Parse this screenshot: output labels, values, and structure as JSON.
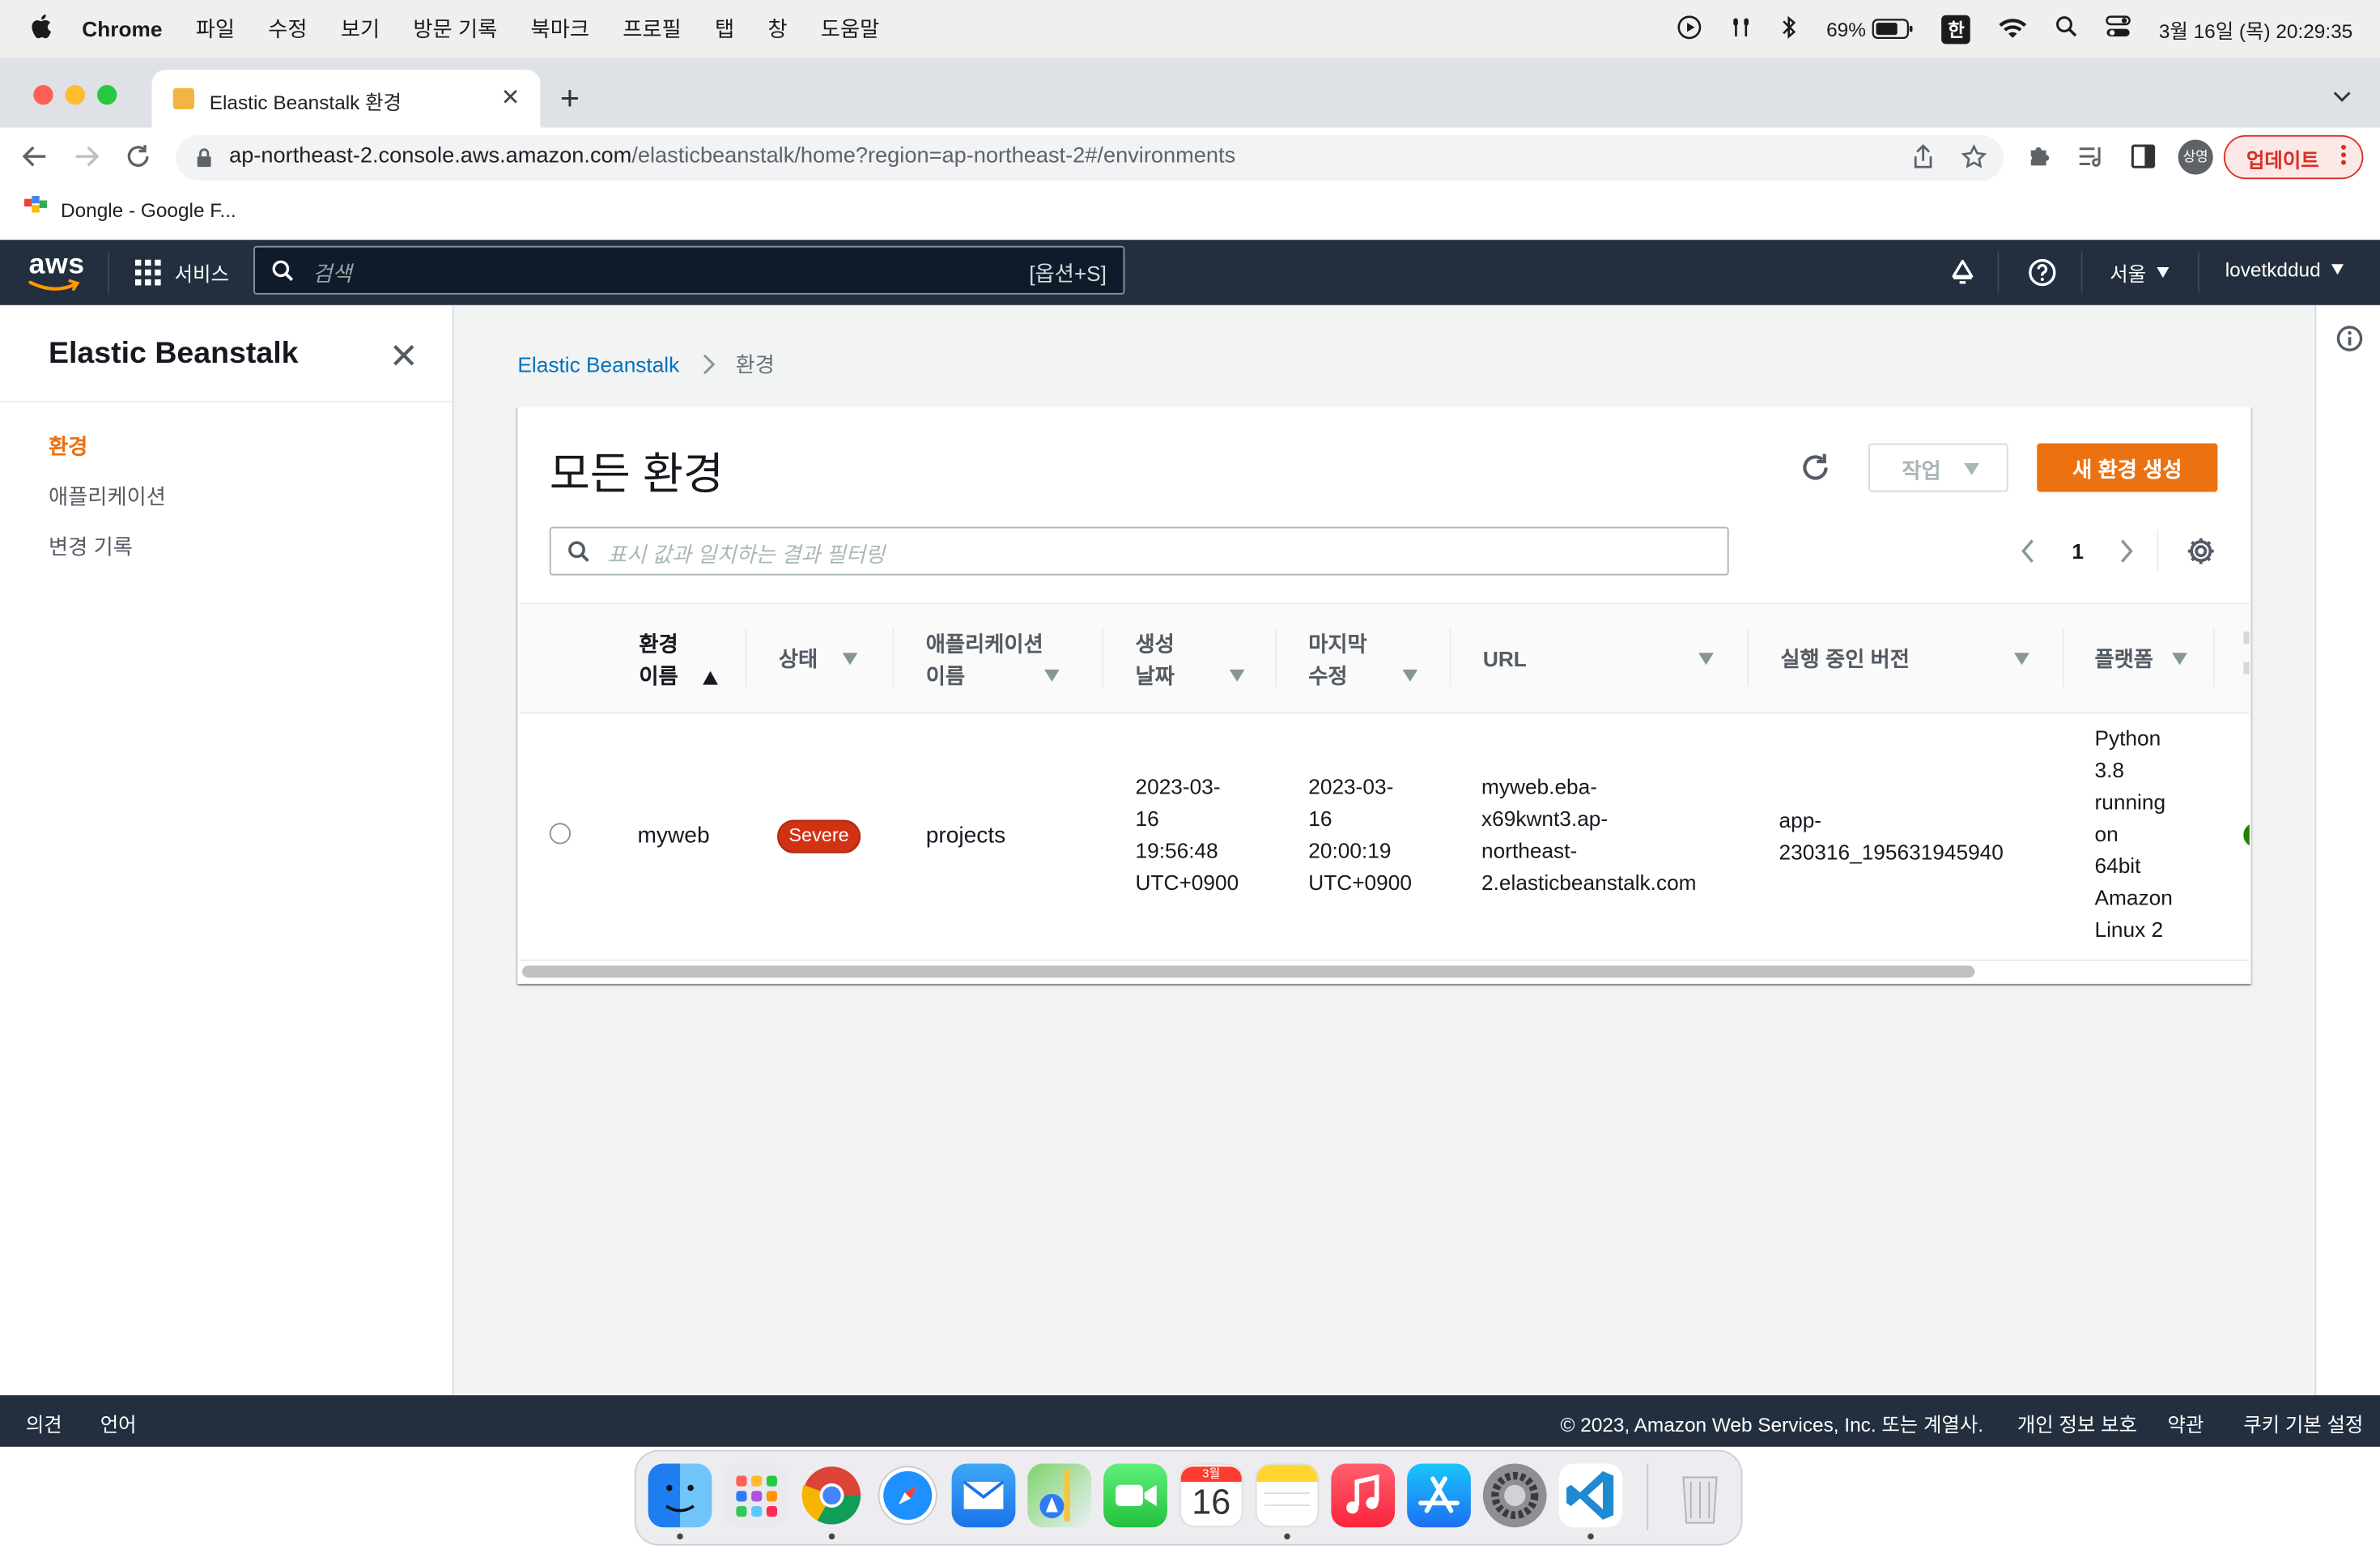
{
  "menubar": {
    "app": "Chrome",
    "items": [
      "파일",
      "수정",
      "보기",
      "방문 기록",
      "북마크",
      "프로필",
      "탭",
      "창",
      "도움말"
    ],
    "battery": "69%",
    "input_method": "한",
    "clock": "3월 16일 (목) 20:29:35"
  },
  "browser": {
    "tab_title": "Elastic Beanstalk 환경",
    "url_domain": "ap-northeast-2.console.aws.amazon.com",
    "url_path": "/elasticbeanstalk/home?region=ap-northeast-2#/environments",
    "profile_label": "상영",
    "update_label": "업데이트",
    "bookmark": "Dongle - Google F..."
  },
  "awsnav": {
    "logo": "aws",
    "services": "서비스",
    "search_placeholder": "검색",
    "search_shortcut": "[옵션+S]",
    "region": "서울",
    "account": "lovetkddud"
  },
  "sidenav": {
    "title": "Elastic Beanstalk",
    "items": [
      {
        "label": "환경",
        "active": true
      },
      {
        "label": "애플리케이션",
        "active": false
      },
      {
        "label": "변경 기록",
        "active": false
      }
    ]
  },
  "breadcrumb": {
    "root": "Elastic Beanstalk",
    "current": "환경"
  },
  "panel": {
    "title": "모든 환경",
    "actions_label": "작업",
    "create_label": "새 환경 생성",
    "filter_placeholder": "표시 값과 일치하는 결과 필터링",
    "page": "1"
  },
  "table": {
    "columns": [
      {
        "l1": "환경",
        "l2": "이름"
      },
      {
        "l1": "상태",
        "l2": ""
      },
      {
        "l1": "애플리케이션",
        "l2": "이름"
      },
      {
        "l1": "생성",
        "l2": "날짜"
      },
      {
        "l1": "마지막",
        "l2": "수정"
      },
      {
        "l1": "URL",
        "l2": ""
      },
      {
        "l1": "실행 중인 버전",
        "l2": ""
      },
      {
        "l1": "플랫폼",
        "l2": ""
      }
    ],
    "row": {
      "env_name": "myweb",
      "status": "Severe",
      "app_name": "projects",
      "created": [
        "2023-03-",
        "16",
        "19:56:48",
        "UTC+0900"
      ],
      "modified": [
        "2023-03-",
        "16",
        "20:00:19",
        "UTC+0900"
      ],
      "url": [
        "myweb.eba-",
        "x69kwnt3.ap-",
        "northeast-",
        "2.elasticbeanstalk.com"
      ],
      "version": [
        "app-",
        "230316_195631945940"
      ],
      "platform": [
        "Python",
        "3.8",
        "running",
        "on",
        "64bit",
        "Amazon",
        "Linux 2"
      ]
    }
  },
  "footer": {
    "feedback": "의견",
    "language": "언어",
    "copyright": "© 2023, Amazon Web Services, Inc. 또는 계열사.",
    "privacy": "개인 정보 보호",
    "terms": "약관",
    "cookies": "쿠키 기본 설정"
  },
  "dock": {
    "calendar_month": "3월",
    "calendar_day": "16"
  },
  "colors": {
    "aws_orange": "#ec7211",
    "aws_nav": "#232f3e",
    "link_blue": "#0073bb",
    "severe_red": "#d13212"
  }
}
